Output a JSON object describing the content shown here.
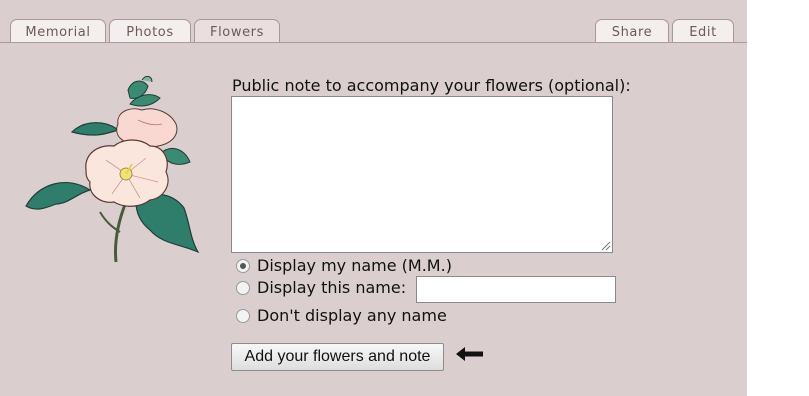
{
  "tabs_left": [
    {
      "label": "Memorial"
    },
    {
      "label": "Photos"
    },
    {
      "label": "Flowers",
      "active": true
    }
  ],
  "tabs_right": [
    {
      "label": "Share"
    },
    {
      "label": "Edit"
    }
  ],
  "form": {
    "note_label": "Public note to accompany your flowers (optional):",
    "note_value": "",
    "display_options": [
      {
        "label": "Display my name (M.M.)",
        "checked": true
      },
      {
        "label": "Display this name:",
        "checked": false
      },
      {
        "label": "Don't display any name",
        "checked": false
      }
    ],
    "custom_name_value": "",
    "submit_label": "Add your flowers and note"
  },
  "icons": {
    "flower": "hibiscus-flower-illustration",
    "arrow": "arrow-left-icon",
    "resize": "resize-grip-icon"
  },
  "colors": {
    "page_bg": "#dacfce",
    "tab_bg": "#f4efee",
    "tab_text": "#6b5a58"
  }
}
